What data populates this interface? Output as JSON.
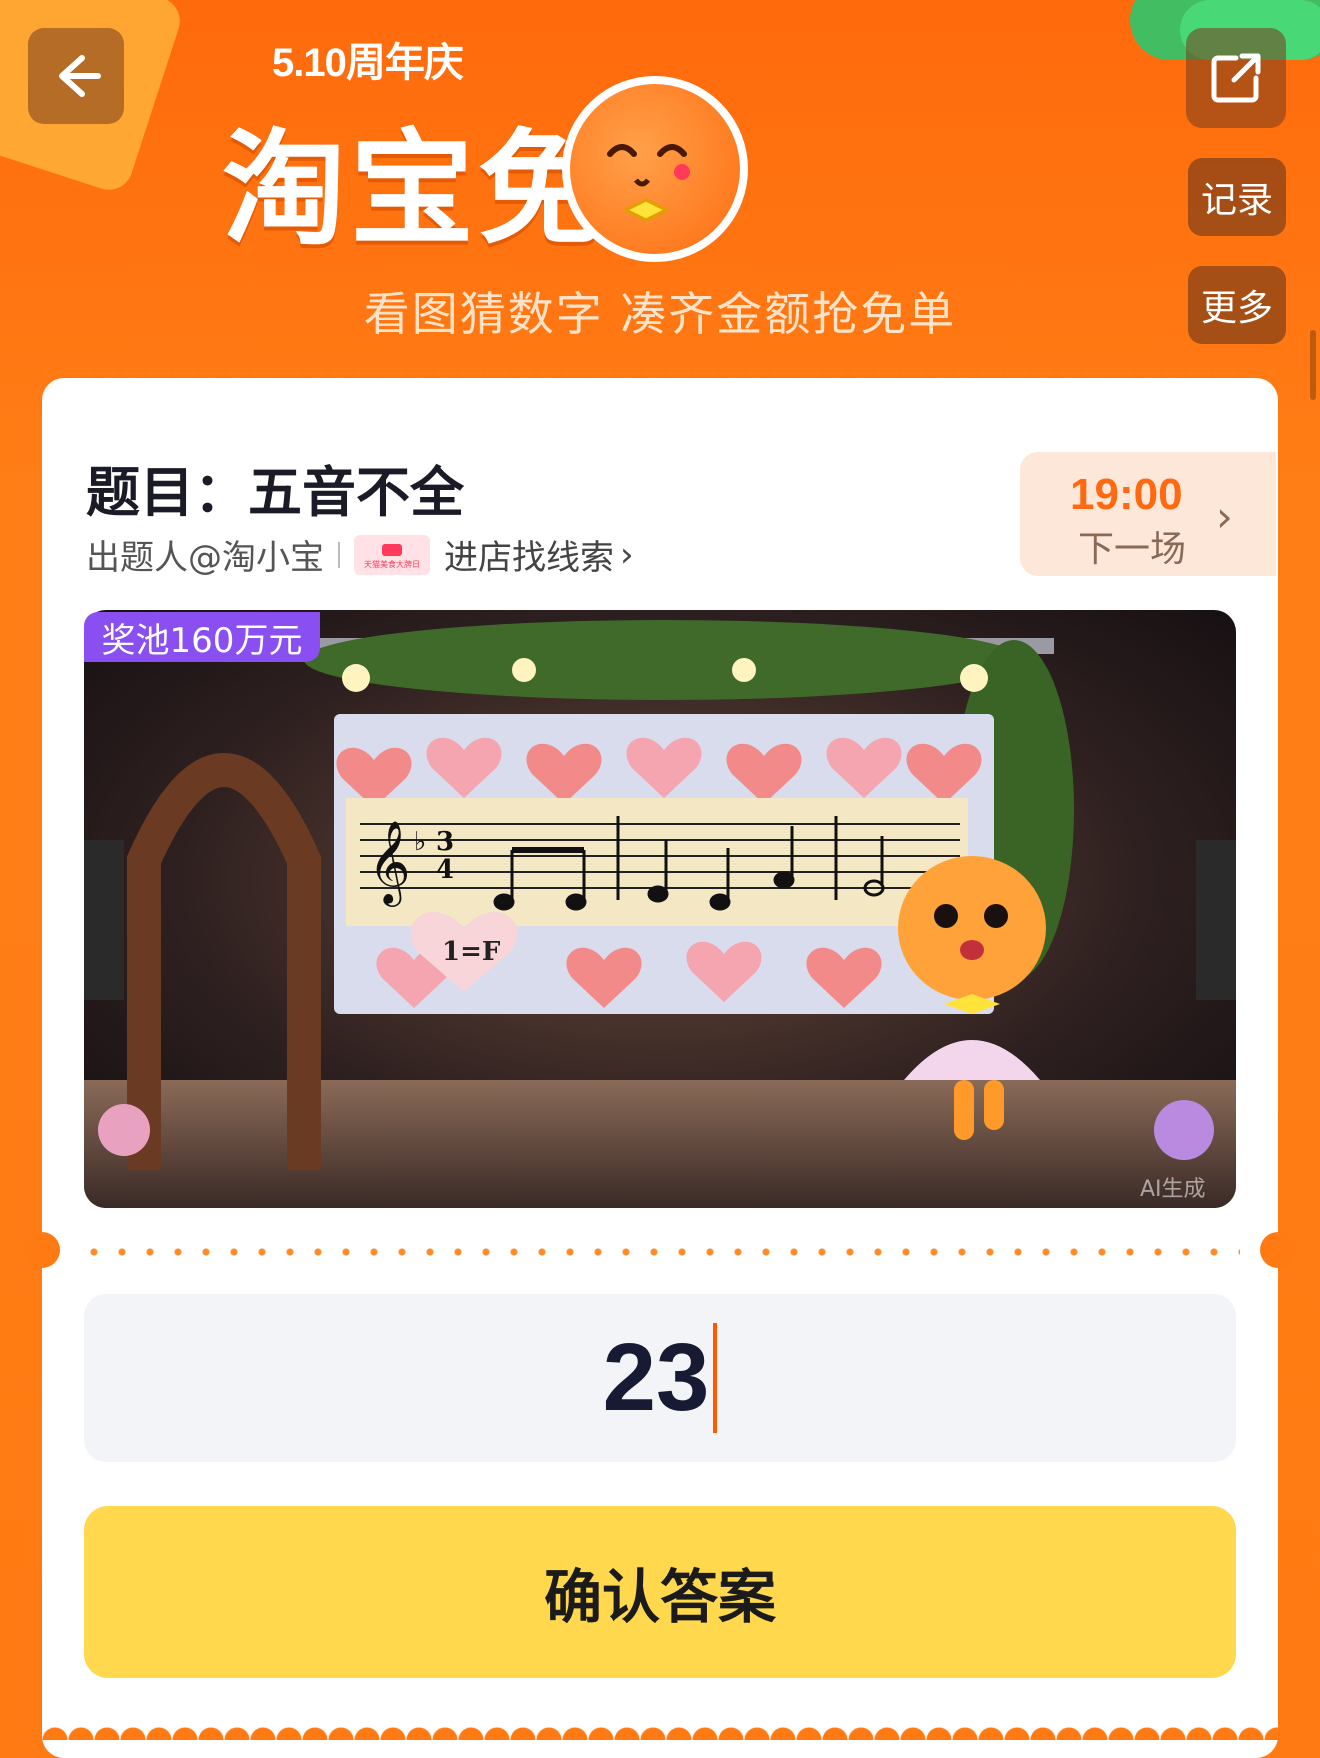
{
  "header": {
    "year_label": "5.10周年庆",
    "headline": "淘宝免单",
    "slogan": "看图猜数字 凑齐金额抢免单"
  },
  "nav": {
    "records_label": "记录",
    "more_label": "更多"
  },
  "question": {
    "title": "题目：五音不全",
    "author": "出题人@淘小宝",
    "store_link": "进店找线索",
    "store_badge_text": "天猫美食大牌日"
  },
  "next_session": {
    "time": "19:00",
    "label": "下一场"
  },
  "puzzle": {
    "prize_pool": "奖池160万元",
    "key_signature": "1=F",
    "ai_label": "AI生成"
  },
  "answer": {
    "value": "23"
  },
  "confirm_button": {
    "label": "确认答案"
  },
  "colors": {
    "brand_orange": "#ff7a12",
    "confirm_yellow": "#ffd84d",
    "prize_purple": "#8a4ff0",
    "next_time_orange": "#ff6a10"
  },
  "icons": [
    "back-arrow-icon",
    "share-icon",
    "chevron-right-icon",
    "treble-clef-icon",
    "heart-icon",
    "mascot-icon"
  ]
}
